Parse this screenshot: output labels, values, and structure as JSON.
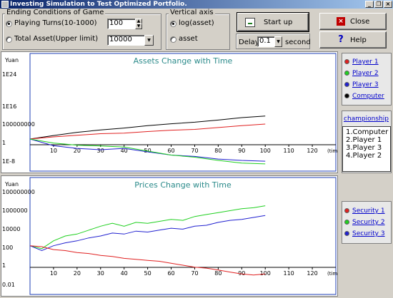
{
  "window": {
    "title": "Investing Simulation to Test Optimized Portfolio.",
    "controls": [
      "_",
      "❐",
      "×"
    ]
  },
  "ending": {
    "group_label": "Ending Conditions of Game",
    "turns_label": "Playing Turns(10-1000)",
    "turns_value": "100",
    "asset_label": "Total Asset(Upper limit)",
    "asset_value": "10000"
  },
  "vertical": {
    "group_label": "Vertical   axis",
    "log_label": "log(asset)",
    "asset_label": "asset"
  },
  "buttons": {
    "start": "Start up",
    "close": "Close",
    "help": "Help"
  },
  "delay": {
    "label": "Delay",
    "value": "0.1",
    "unit": "second"
  },
  "players_legend": [
    {
      "label": "Player 1",
      "color": "#e02020"
    },
    {
      "label": "Player 2",
      "color": "#20d020"
    },
    {
      "label": "Player 3",
      "color": "#2020d0"
    },
    {
      "label": "Computer",
      "color": "#000000"
    }
  ],
  "championship": {
    "title": "championship",
    "items": [
      "1.Computer",
      "2.Player 1",
      "3.Player 3",
      "4.Player 2"
    ]
  },
  "securities_legend": [
    {
      "label": "Security 1",
      "color": "#e02020"
    },
    {
      "label": "Security 2",
      "color": "#20d020"
    },
    {
      "label": "Security 3",
      "color": "#2020d0"
    }
  ],
  "chart_data": [
    {
      "type": "line",
      "title": "Assets Change with Time",
      "ylabel": "Yuan",
      "xlabel": "time",
      "log_scale": true,
      "ytick_labels": [
        "1E24",
        "1E16",
        "100000000",
        "1",
        "1E-8"
      ],
      "xticks": [
        10,
        20,
        30,
        40,
        50,
        60,
        70,
        80,
        90,
        100,
        110,
        120
      ],
      "xlim": [
        0,
        130
      ],
      "ylim_exp": [
        -12,
        32
      ],
      "x": [
        0,
        10,
        20,
        30,
        40,
        50,
        60,
        70,
        80,
        90,
        100
      ],
      "series": [
        {
          "color": "#000000",
          "log10": [
            0,
            1.3,
            2.5,
            3.4,
            4.1,
            5.0,
            5.7,
            6.3,
            7.1,
            8.0,
            8.6
          ]
        },
        {
          "color": "#e02020",
          "log10": [
            0,
            0.8,
            1.4,
            2.0,
            2.2,
            2.8,
            3.3,
            3.6,
            4.3,
            5.0,
            5.6
          ]
        },
        {
          "color": "#2020d0",
          "log10": [
            0,
            -2.5,
            -3.5,
            -4.0,
            -3.5,
            -4.8,
            -6.0,
            -6.5,
            -7.5,
            -8.0,
            -8.3
          ]
        },
        {
          "color": "#20d020",
          "log10": [
            0,
            -1.5,
            -2.3,
            -2.6,
            -3.0,
            -4.5,
            -6.0,
            -6.8,
            -8.0,
            -9.0,
            -9.3
          ]
        }
      ]
    },
    {
      "type": "line",
      "title": "Prices Change with Time",
      "ylabel": "Yuan",
      "xlabel": "time",
      "log_scale": true,
      "ytick_labels": [
        "100000000",
        "1000000",
        "10000",
        "100",
        "1",
        "0.01"
      ],
      "xticks": [
        10,
        20,
        30,
        40,
        50,
        60,
        70,
        80,
        90,
        100,
        110,
        120
      ],
      "xlim": [
        0,
        130
      ],
      "ylim_exp": [
        -3,
        9
      ],
      "x": [
        0,
        5,
        10,
        15,
        20,
        25,
        30,
        35,
        40,
        45,
        50,
        55,
        60,
        65,
        70,
        75,
        80,
        85,
        90,
        95,
        100
      ],
      "series": [
        {
          "color": "#20d020",
          "log10": [
            2.0,
            1.7,
            2.5,
            3.0,
            3.2,
            3.6,
            4.0,
            4.3,
            4.0,
            4.4,
            4.3,
            4.5,
            4.7,
            4.6,
            5.0,
            5.2,
            5.4,
            5.6,
            5.8,
            5.9,
            6.1
          ]
        },
        {
          "color": "#2020d0",
          "log10": [
            2.0,
            1.5,
            2.0,
            2.3,
            2.5,
            2.8,
            3.0,
            3.3,
            3.2,
            3.5,
            3.4,
            3.6,
            3.8,
            3.7,
            4.0,
            4.1,
            4.4,
            4.6,
            4.7,
            4.9,
            5.1
          ]
        },
        {
          "color": "#e02020",
          "log10": [
            2.0,
            1.9,
            1.6,
            1.5,
            1.3,
            1.2,
            1.0,
            0.9,
            0.7,
            0.6,
            0.5,
            0.4,
            0.2,
            0.0,
            -0.2,
            -0.3,
            -0.5,
            -0.7,
            -0.9,
            -1.0,
            -0.9
          ]
        }
      ]
    }
  ]
}
